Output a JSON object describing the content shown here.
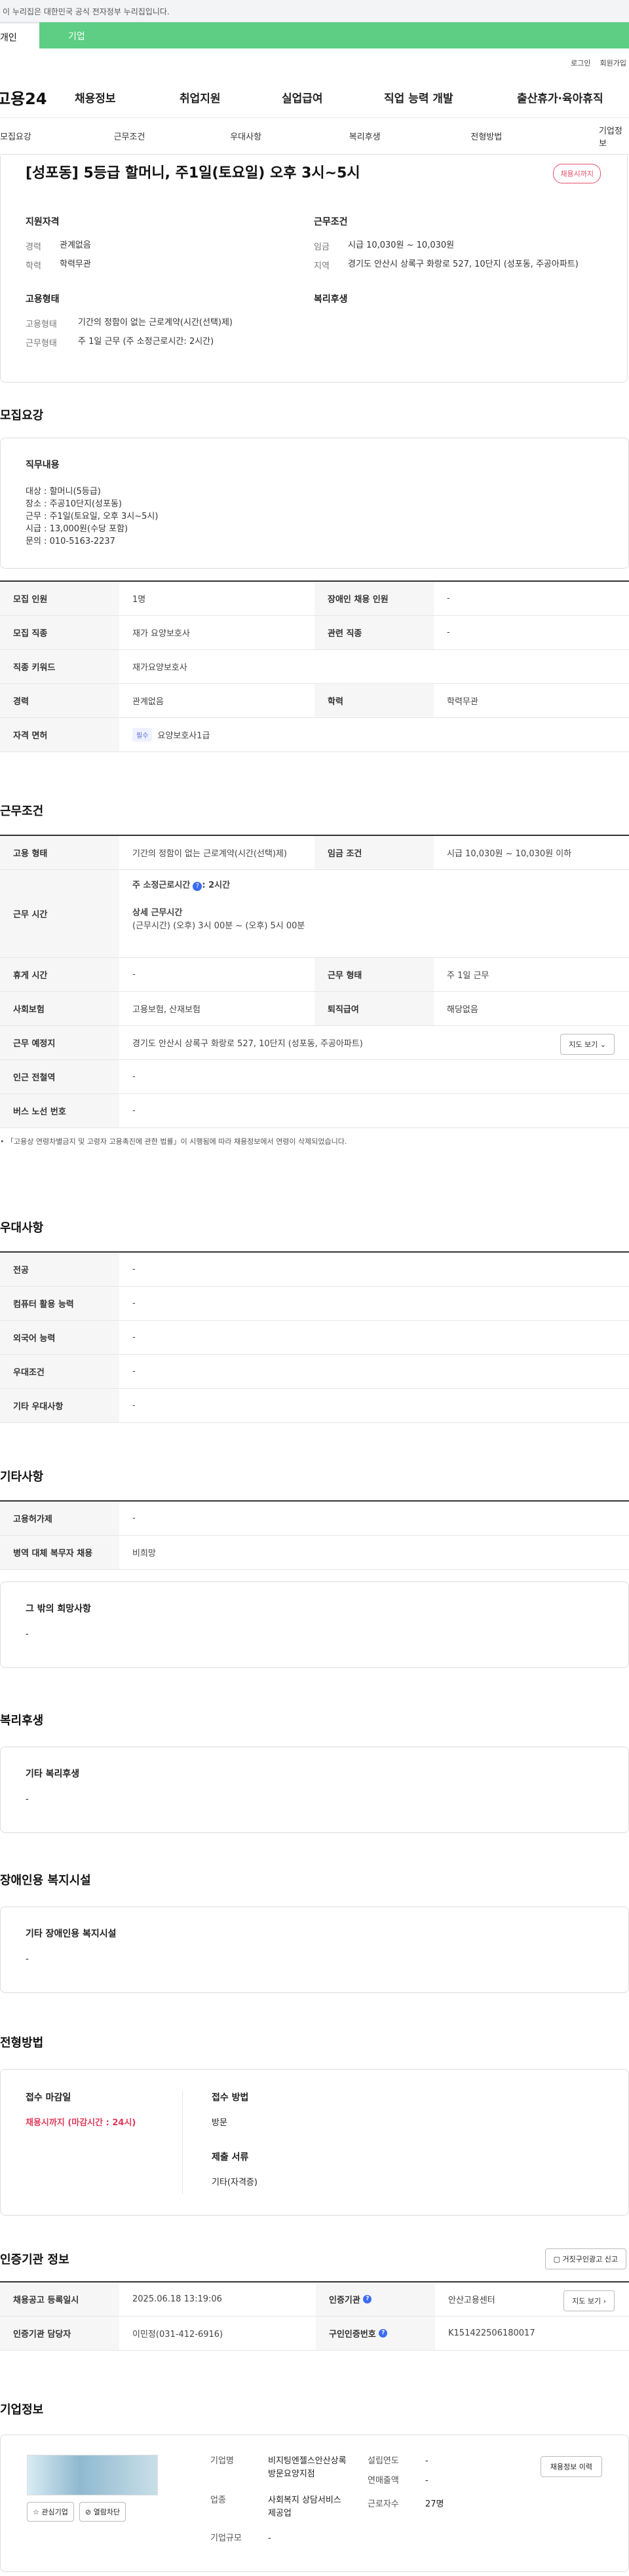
{
  "gov_bar": {
    "text": "이 누리집은 대한민국 공식 전자정부 누리집입니다."
  },
  "user_type": {
    "personal": "개인",
    "company": "기업"
  },
  "util": {
    "login": "로그인",
    "join": "회원가입"
  },
  "gnb": {
    "logo": "고용24",
    "items": [
      "채용정보",
      "취업지원",
      "실업급여",
      "직업 능력 개발",
      "출산휴가·육아휴직"
    ]
  },
  "subnav": [
    "모집요강",
    "근무조건",
    "우대사항",
    "복리후생",
    "전형방법",
    "기업정보"
  ],
  "hero": {
    "title": "[성포동] 5등급 할머니, 주1일(토요일) 오후 3시~5시",
    "badge": "채용시까지",
    "qual_title": "지원자격",
    "career_k": "경력",
    "career_v": "관계없음",
    "edu_k": "학력",
    "edu_v": "학력무관",
    "work_title": "근무조건",
    "wage_k": "임금",
    "wage_v": "시급 10,030원 ~ 10,030원",
    "area_k": "지역",
    "area_v": "경기도 안산시 상록구 화랑로 527, 10단지 (성포동, 주공아파트)",
    "emp_title": "고용형태",
    "emp_k": "고용형태",
    "emp_v": "기간의 정함이 없는 근로계약(시간(선택)제)",
    "wtype_k": "근무형태",
    "wtype_v": "주 1일 근무 (주 소정근로시간: 2시간)",
    "welfare_title": "복리후생"
  },
  "recruit": {
    "section": "모집요강",
    "job_title": "직무내용",
    "job_lines": [
      "대상 : 할머니(5등급)",
      "장소 : 주공10단지(성포동)",
      "근무 : 주1일(토요일, 오후 3시~5시)",
      "시급 : 13,000원(수당 포함)",
      "문의 : 010-5163-2237"
    ],
    "rows": [
      {
        "k": "모집 인원",
        "v": "1명",
        "k2": "장애인 채용 인원",
        "v2": "-"
      },
      {
        "k": "모집 직종",
        "v": "재가 요양보호사",
        "k2": "관련 직종",
        "v2": "-"
      },
      {
        "k": "직종 키워드",
        "v": "재가요양보호사"
      },
      {
        "k": "경력",
        "v": "관계없음",
        "k2": "학력",
        "v2": "학력무관"
      },
      {
        "k": "자격 면허",
        "tag": "필수",
        "v": "요양보호사1급"
      }
    ]
  },
  "work": {
    "section": "근무조건",
    "emp_k": "고용 형태",
    "emp_v": "기간의 정함이 없는 근로계약(시간(선택)제)",
    "wage_k": "임금 조건",
    "wage_v": "시급 10,030원 ~ 10,030원 이하",
    "time_k": "근무 시간",
    "time_weekly": "주 소정근로시간",
    "time_weekly_v": ": 2시간",
    "time_detail_title": "상세 근무시간",
    "time_detail": "(근무시간) (오후) 3시 00분 ~ (오후) 5시 00분",
    "rest_k": "휴게 시간",
    "rest_v": "-",
    "wform_k": "근무 형태",
    "wform_v": "주 1일 근무",
    "ins_k": "사회보험",
    "ins_v": "고용보험, 산재보험",
    "ret_k": "퇴직급여",
    "ret_v": "해당없음",
    "place_k": "근무 예정지",
    "place_v": "경기도 안산시 상록구 화랑로 527, 10단지 (성포동, 주공아파트)",
    "map_btn": "지도 보기",
    "station_k": "인근 전철역",
    "station_v": "-",
    "bus_k": "버스 노선 번호",
    "bus_v": "-",
    "note": "「고용상 연령차별금지 및 고령자 고용촉진에 관한 법률」이 시행됨에 따라 채용정보에서 연령이 삭제되었습니다."
  },
  "pref": {
    "section": "우대사항",
    "rows": [
      {
        "k": "전공",
        "v": "-"
      },
      {
        "k": "컴퓨터 활용 능력",
        "v": "-"
      },
      {
        "k": "외국어 능력",
        "v": "-"
      },
      {
        "k": "우대조건",
        "v": "-"
      },
      {
        "k": "기타 우대사항",
        "v": "-"
      }
    ]
  },
  "etc": {
    "section": "기타사항",
    "rows": [
      {
        "k": "고용허가제",
        "v": "-"
      },
      {
        "k": "병역 대체 복무자 채용",
        "v": "비희망"
      }
    ],
    "hope_title": "그 밖의 희망사항",
    "hope_v": "-"
  },
  "welfare": {
    "section": "복리후생",
    "title": "기타 복리후생",
    "v": "-"
  },
  "disab": {
    "section": "장애인용 복지시설",
    "title": "기타 장애인용 복지시설",
    "v": "-"
  },
  "select": {
    "section": "전형방법",
    "deadline_k": "접수 마감일",
    "deadline_v": "채용시까지 (마감시간 : 24시)",
    "method_k": "접수 방법",
    "method_v": "방문",
    "docs_k": "제출 서류",
    "docs_v": "기타(자격증)"
  },
  "cert": {
    "section": "인증기관 정보",
    "report_btn": "거짓구인광고 신고",
    "reg_k": "채용공고 등록일시",
    "reg_v": "2025.06.18 13:19:06",
    "org_k": "인증기관",
    "org_v": "안산고용센터",
    "map_btn": "지도 보기",
    "mgr_k": "인증기관 담당자",
    "mgr_v": "이민정(031-412-6916)",
    "cert_k": "구인인증번호",
    "cert_v": "K151422506180017"
  },
  "company": {
    "section": "기업정보",
    "name_k": "기업명",
    "name_v": "비지팅엔젤스안산상록방문요양지점",
    "ind_k": "업종",
    "ind_v": "사회복지 상담서비스 제공업",
    "size_k": "기업규모",
    "size_v": "-",
    "est_k": "설립연도",
    "est_v": "-",
    "sales_k": "연매출액",
    "sales_v": "-",
    "emp_k": "근로자수",
    "emp_v": "27명",
    "hist_btn": "채용정보 이력",
    "fav_btn": "관심기업",
    "block_btn": "열람차단"
  }
}
